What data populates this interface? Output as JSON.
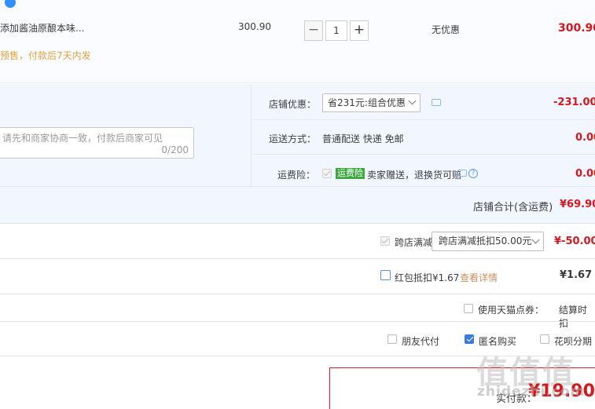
{
  "item": {
    "badge_icon": "info-badge-icon",
    "name": "添加酱油原酿本味...",
    "presale_note": "预售，付款后7天内发",
    "unit_price": "300.90",
    "quantity": "1",
    "minus_label": "−",
    "plus_label": "+",
    "discount": "无优惠",
    "total": "300.90"
  },
  "shop": {
    "message_placeholder": "请先和商家协商一致，付款后商家可见",
    "message_count": "0/200",
    "discount_label": "店铺优惠：",
    "discount_select": "省231元:组合优惠",
    "discount_value": "-231.00",
    "shipping_label": "运送方式：",
    "shipping_value": "普通配送 快递 免邮",
    "shipping_price": "0.00",
    "insurance_label": "运费险：",
    "insurance_tag": "运费险",
    "insurance_text": "卖家赠送，退换货可赔",
    "insurance_price": "0.00",
    "subtotal_label": "店铺合计(含运费)",
    "subtotal_value": "¥69.90"
  },
  "cross_store": {
    "label": "跨店满减",
    "select": "跨店满减抵扣50.00元",
    "value": "¥-50.00"
  },
  "red_packet": {
    "label": "红包抵扣¥1.67",
    "link": "查看详情",
    "value": "¥1.67"
  },
  "points": {
    "label": "使用天猫点券：",
    "settle": "结算时扣"
  },
  "options": {
    "friend_pay": "朋友代付",
    "anonymous": "匿名购买",
    "huabei": "花呗分期"
  },
  "payment": {
    "label": "实付款：",
    "value": "¥19.90"
  },
  "watermark": {
    "big": "值值值",
    "url": "zhidezhi.com"
  },
  "colors": {
    "price_red": "#d9161b",
    "accent_blue": "#3b7ae0",
    "shop_bg": "#f2f7ff"
  }
}
